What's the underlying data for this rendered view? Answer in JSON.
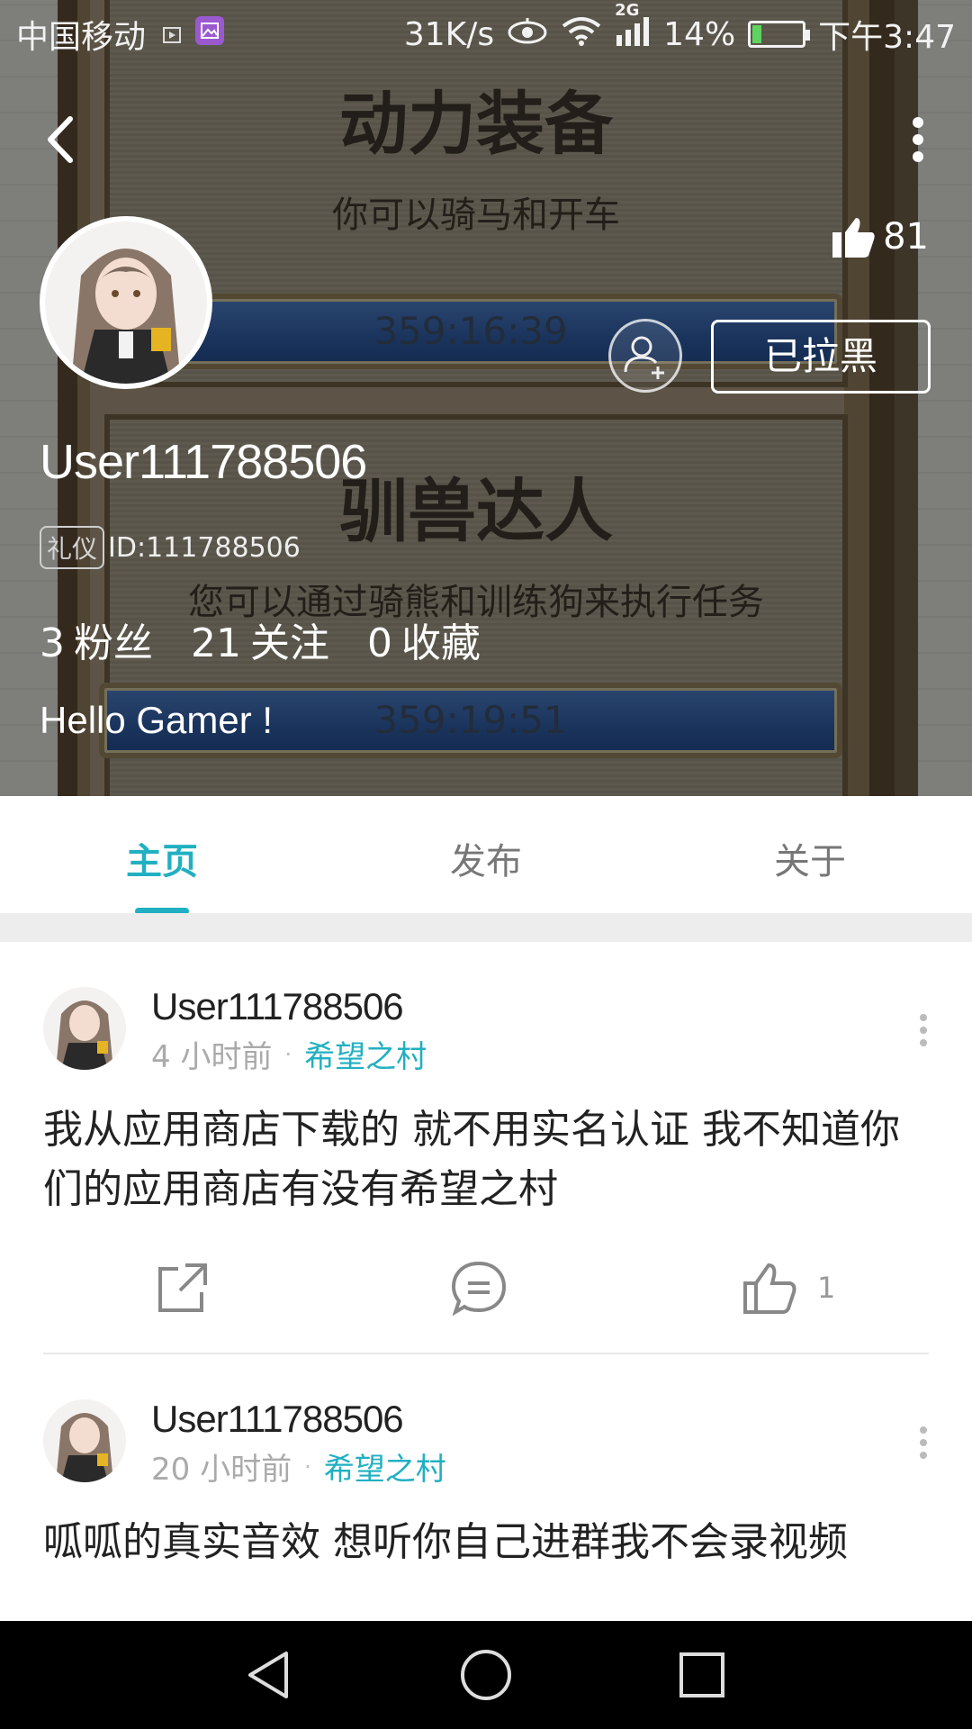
{
  "status_bar": {
    "carrier": "中国移动",
    "speed": "31K/s",
    "network": "2G",
    "battery": "14%",
    "time": "下午3:47"
  },
  "background": {
    "title1": "动力装备",
    "sub1": "你可以骑马和开车",
    "timer1": "359:16:39",
    "title2": "驯兽达人",
    "sub2": "您可以通过骑熊和训练狗来执行任务",
    "timer2": "359:19:51"
  },
  "profile": {
    "likes": "81",
    "blocked_label": "已拉黑",
    "username": "User111788506",
    "badge": "礼仪",
    "id": "ID:111788506",
    "stats": [
      {
        "num": "3",
        "label": "粉丝"
      },
      {
        "num": "21",
        "label": "关注"
      },
      {
        "num": "0",
        "label": "收藏"
      }
    ],
    "bio": "Hello Gamer !"
  },
  "tabs": [
    {
      "label": "主页"
    },
    {
      "label": "发布"
    },
    {
      "label": "关于"
    }
  ],
  "posts": [
    {
      "author": "User111788506",
      "time": "4 小时前",
      "topic": "希望之村",
      "text": "我从应用商店下载的 就不用实名认证 我不知道你们的应用商店有没有希望之村",
      "likes": "1"
    },
    {
      "author": "User111788506",
      "time": "20 小时前",
      "topic": "希望之村",
      "text": "呱呱的真实音效  想听你自己进群我不会录视频"
    }
  ],
  "colors": {
    "accent": "#21b0c1"
  }
}
